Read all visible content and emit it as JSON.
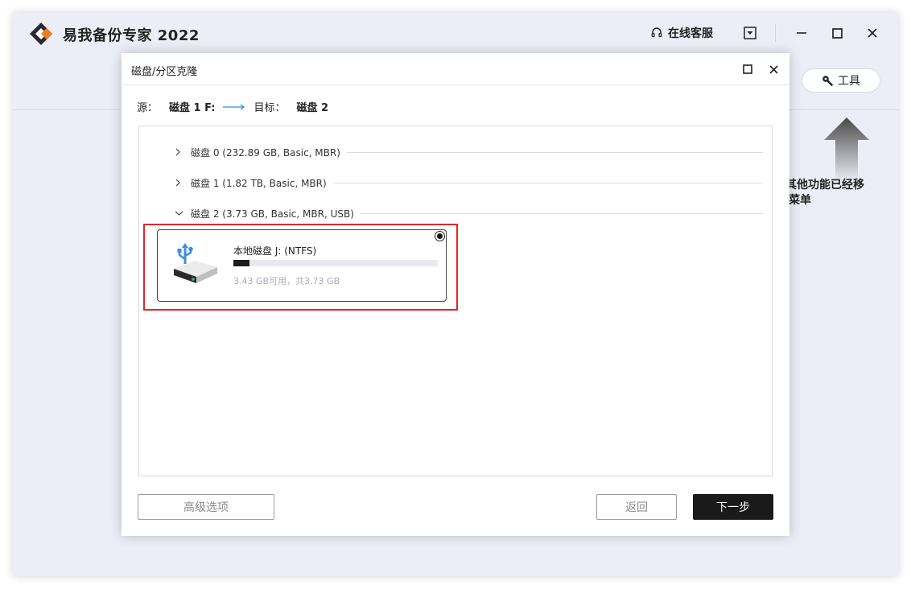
{
  "app": {
    "title": "易我备份专家 2022",
    "support_label": "在线客服",
    "tools_label": "工具",
    "moved_hint_line1": "其他功能已经移",
    "moved_hint_line2": "菜单",
    "accent_orange": "#f07c22",
    "background": "#eceef7"
  },
  "dialog": {
    "title": "磁盘/分区克隆",
    "route": {
      "source_label": "源：",
      "source_value": "磁盘 1 F:",
      "target_label": "目标：",
      "target_value": "磁盘 2"
    },
    "disks": [
      {
        "label": "磁盘 0 (232.89 GB, Basic, MBR)",
        "expanded": false
      },
      {
        "label": "磁盘 1 (1.82 TB, Basic, MBR)",
        "expanded": false
      },
      {
        "label": "磁盘 2 (3.73 GB, Basic, MBR, USB)",
        "expanded": true
      }
    ],
    "partition": {
      "name": "本地磁盘 J: (NTFS)",
      "free_text": "3.43 GB可用，共3.73 GB",
      "used_fraction": 0.08,
      "selected": true
    },
    "buttons": {
      "advanced": "高级选项",
      "back": "返回",
      "next": "下一步"
    },
    "highlight_color": "#e0282e"
  }
}
